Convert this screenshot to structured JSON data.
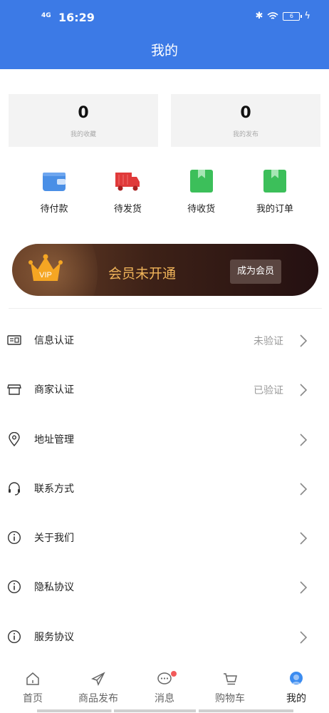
{
  "status_bar": {
    "network": "4G",
    "time": "16:29",
    "battery": "6"
  },
  "header": {
    "title": "我的"
  },
  "stats": [
    {
      "value": "0",
      "label": "我的收藏"
    },
    {
      "value": "0",
      "label": "我的发布"
    }
  ],
  "orders": [
    {
      "label": "待付款",
      "icon": "wallet-icon",
      "color": "#4a8fe6"
    },
    {
      "label": "待发货",
      "icon": "truck-icon",
      "color": "#e03a3a"
    },
    {
      "label": "待收货",
      "icon": "package-icon",
      "color": "#3cbf5a"
    },
    {
      "label": "我的订单",
      "icon": "order-book-icon",
      "color": "#3cbf5a"
    }
  ],
  "vip": {
    "badge": "VIP",
    "status_text": "会员未开通",
    "button_label": "成为会员"
  },
  "menu": [
    {
      "label": "信息认证",
      "value": "未验证",
      "icon": "id-card-icon"
    },
    {
      "label": "商家认证",
      "value": "已验证",
      "icon": "storefront-icon"
    },
    {
      "label": "地址管理",
      "value": "",
      "icon": "location-pin-icon"
    },
    {
      "label": "联系方式",
      "value": "",
      "icon": "headset-icon"
    },
    {
      "label": "关于我们",
      "value": "",
      "icon": "info-icon"
    },
    {
      "label": "隐私协议",
      "value": "",
      "icon": "info-icon"
    },
    {
      "label": "服务协议",
      "value": "",
      "icon": "info-icon"
    }
  ],
  "tabs": [
    {
      "label": "首页",
      "icon": "home-icon"
    },
    {
      "label": "商品发布",
      "icon": "send-icon"
    },
    {
      "label": "消息",
      "icon": "message-icon"
    },
    {
      "label": "购物车",
      "icon": "cart-icon"
    },
    {
      "label": "我的",
      "icon": "profile-icon",
      "active": true
    }
  ],
  "colors": {
    "header": "#3c7ae6",
    "vip_text": "#f0b45a",
    "active_tab": "#3c8cf0"
  }
}
